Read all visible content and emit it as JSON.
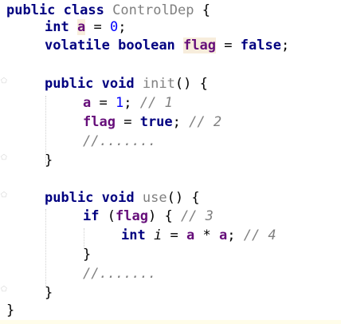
{
  "code": {
    "l1": {
      "kw1": "public",
      "kw2": "class",
      "name": "ControlDep",
      "brace": "{"
    },
    "l2": {
      "kw": "int",
      "field": "a",
      "eq": "=",
      "num": "0",
      "semi": ";"
    },
    "l3": {
      "kw1": "volatile",
      "kw2": "boolean",
      "field": "flag",
      "eq": "=",
      "kw3": "false",
      "semi": ";"
    },
    "l5": {
      "kw1": "public",
      "kw2": "void",
      "name": "init",
      "parens": "()",
      "brace": "{"
    },
    "l6": {
      "field": "a",
      "eq": "=",
      "num": "1",
      "semi": ";",
      "comment": "// 1"
    },
    "l7": {
      "field": "flag",
      "eq": "=",
      "kw": "true",
      "semi": ";",
      "comment": "// 2"
    },
    "l8": {
      "comment": "//......."
    },
    "l9": {
      "brace": "}"
    },
    "l11": {
      "kw1": "public",
      "kw2": "void",
      "name": "use",
      "parens": "()",
      "brace": "{"
    },
    "l12": {
      "kw": "if",
      "open": "(",
      "field": "flag",
      "close": ")",
      "brace": "{",
      "comment": "// 3"
    },
    "l13": {
      "kw": "int",
      "local": "i",
      "eq": "=",
      "f1": "a",
      "op": "*",
      "f2": "a",
      "semi": ";",
      "comment": "// 4"
    },
    "l14": {
      "brace": "}"
    },
    "l15": {
      "comment": "//......."
    },
    "l16": {
      "brace": "}"
    },
    "l17": {
      "brace": "}"
    }
  },
  "colors": {
    "keyword": "#000080",
    "field": "#660e7a",
    "number": "#0000ff",
    "comment": "#808080",
    "highlight": "#f7eddc"
  },
  "gutter_icons": [
    "fold-icon",
    "fold-icon",
    "fold-icon",
    "fold-icon",
    "fold-icon",
    "fold-icon"
  ]
}
